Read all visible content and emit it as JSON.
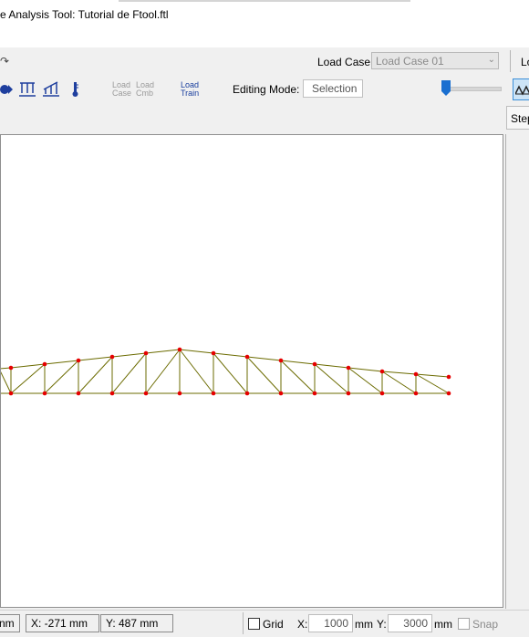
{
  "window": {
    "title": "e Analysis Tool: Tutorial de Ftool.ftl"
  },
  "toolbar1": {
    "redo_icon": "redo-arrow-icon",
    "load_case_label": "Load Case:",
    "load_case_value": "Load Case 01",
    "clipped_label": "Lo"
  },
  "toolbar2": {
    "icons": [
      "support-icon",
      "distributed-load-icon",
      "linear-load-icon",
      "thermal-load-icon"
    ],
    "load_case_label": "Load\nCase",
    "load_cmb_label": "Load\nCmb",
    "load_train_label": "Load\nTrain",
    "editing_mode_label": "Editing Mode:",
    "editing_mode_value": "Selection",
    "zoom_slider_value": 0.05,
    "truss_icon": "truss-icon"
  },
  "side_tab": {
    "label": "Step"
  },
  "status": {
    "partial_unit": "nm",
    "x_coord": "X: -271 mm",
    "y_coord": "Y: 487 mm",
    "grid_label": "Grid",
    "grid_x_label": "X:",
    "grid_x_value": "1000",
    "grid_x_unit": "mm",
    "grid_y_label": "Y:",
    "grid_y_value": "3000",
    "grid_y_unit": "mm",
    "snap_label": "Snap"
  },
  "colors": {
    "truss_member": "#6b6b00",
    "node": "#e60000",
    "accent": "#1a6fd0"
  }
}
